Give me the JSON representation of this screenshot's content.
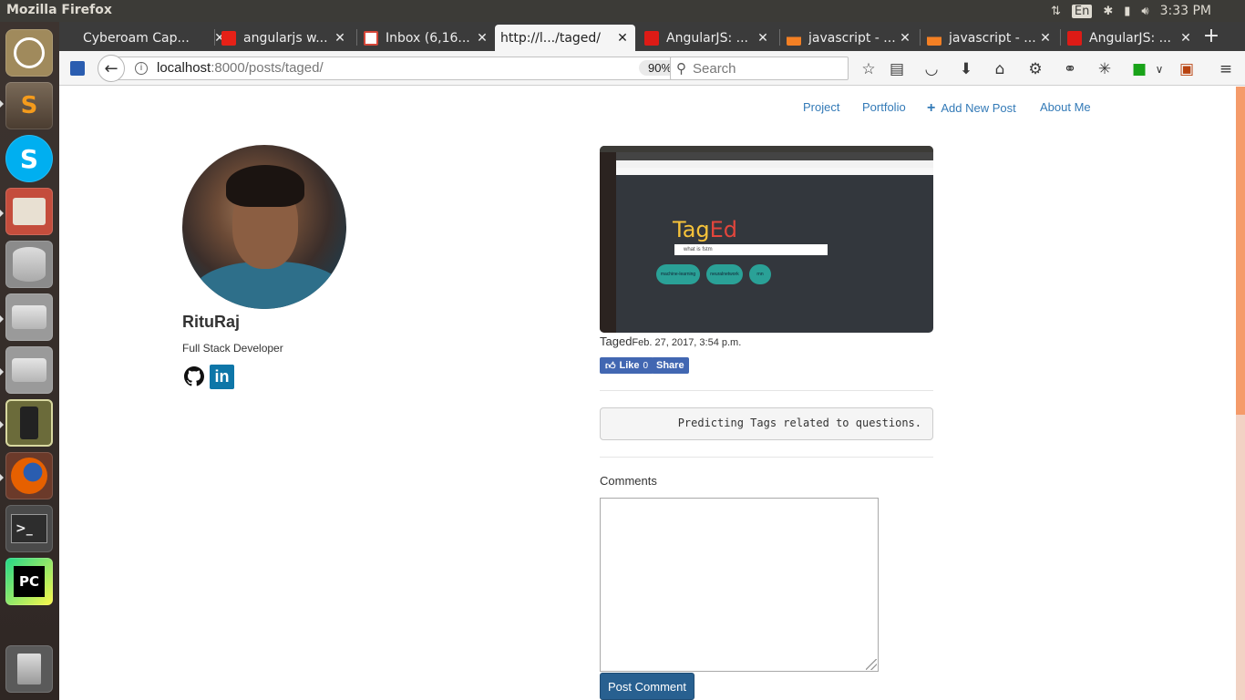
{
  "system": {
    "app_title": "Mozilla Firefox",
    "keyboard_layout": "En",
    "clock": "3:33 PM"
  },
  "launcher": {
    "items": [
      {
        "name": "ubuntu-dash",
        "color": "#a08a5c"
      },
      {
        "name": "sublime-text",
        "color": "#6b5a4a"
      },
      {
        "name": "skype",
        "color": "#00aff0"
      },
      {
        "name": "file-manager",
        "color": "#c44d3c"
      },
      {
        "name": "database",
        "color": "#8b8b8b"
      },
      {
        "name": "disk",
        "color": "#9a9a9a"
      },
      {
        "name": "disk-2",
        "color": "#9a9a9a"
      },
      {
        "name": "phone",
        "color": "#6b6b3a"
      },
      {
        "name": "firefox",
        "color": "#e66000"
      },
      {
        "name": "terminal",
        "color": "#2d2d2d"
      },
      {
        "name": "pycharm",
        "color": "#21d789"
      },
      {
        "name": "trash",
        "color": "#6b6b6b"
      }
    ]
  },
  "tabs": [
    {
      "title": "Cyberoam Cap...",
      "icon_color": "#3b3b3b"
    },
    {
      "title": "angularjs w...",
      "icon_color": "#e62117"
    },
    {
      "title": "Inbox (6,16...",
      "icon_color": "#d44638"
    },
    {
      "title": "http://l.../taged/",
      "icon_color": "#f5f5f5",
      "active": true
    },
    {
      "title": "AngularJS: ...",
      "icon_color": "#dd1b16"
    },
    {
      "title": "javascript - ...",
      "icon_color": "#f48024"
    },
    {
      "title": "javascript - ...",
      "icon_color": "#f48024"
    },
    {
      "title": "AngularJS: ...",
      "icon_color": "#dd1b16"
    }
  ],
  "navbar": {
    "url_host": "localhost",
    "url_rest": ":8000/posts/taged/",
    "zoom": "90%",
    "search_placeholder": "Search"
  },
  "site_nav": {
    "project": "Project",
    "portfolio": "Portfolio",
    "add_post": "Add New Post",
    "about": "About Me"
  },
  "profile": {
    "name": "RituRaj",
    "role": "Full Stack Developer"
  },
  "post": {
    "thumb_logo_tag": "Tag",
    "thumb_logo_ed": "Ed",
    "thumb_search": "what is fstm",
    "thumb_tags": [
      "machine-learning",
      "neuralnetwork",
      "rnn"
    ],
    "title": "Taged",
    "date": "Feb. 27, 2017, 3:54 p.m.",
    "like_label": "Like",
    "like_count": "0",
    "share_label": "Share",
    "body": "Predicting Tags related to questions."
  },
  "comments": {
    "label": "Comments",
    "submit_label": "Post Comment"
  },
  "colors": {
    "accent_link": "#337ab7",
    "button_primary": "#286090",
    "facebook": "#4267b2",
    "scroll_thumb": "#f59b6a"
  }
}
